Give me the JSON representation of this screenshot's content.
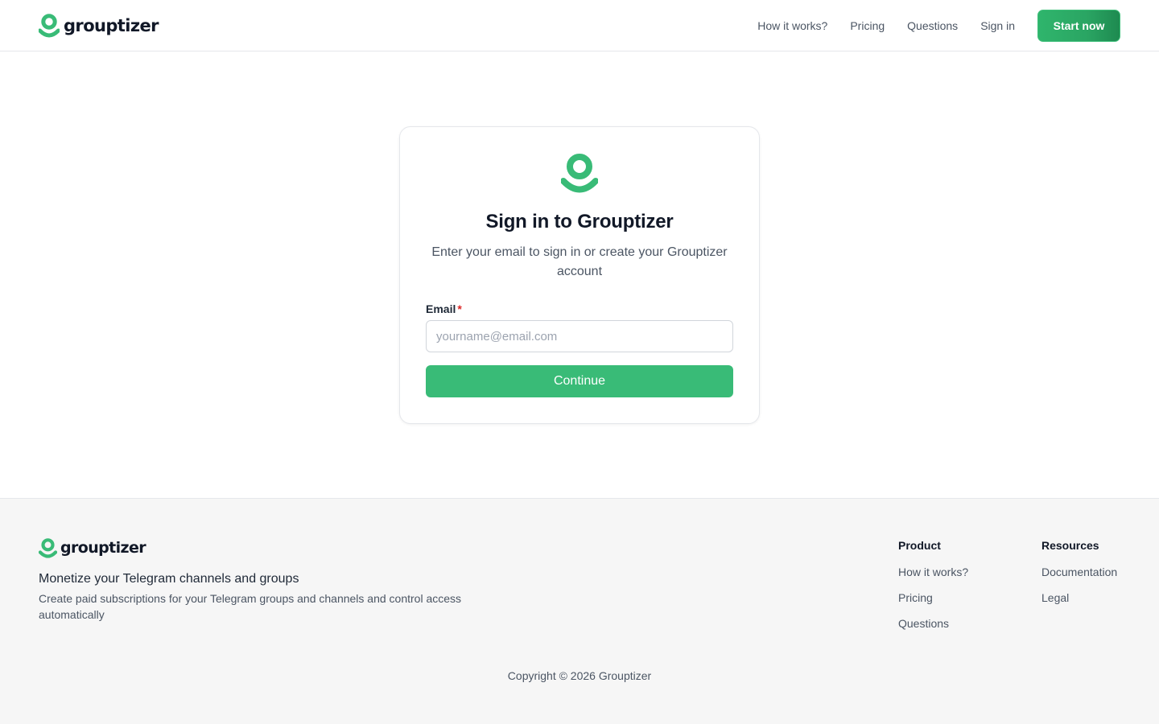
{
  "colors": {
    "brand": "#39bb77",
    "text": "#111827",
    "muted": "#4b5563",
    "required": "#dc2626"
  },
  "header": {
    "brand_name": "grouptizer",
    "logo_icon": "person-pin-icon",
    "nav": {
      "how_it_works": "How it works?",
      "pricing": "Pricing",
      "questions": "Questions",
      "sign_in": "Sign in"
    },
    "cta_label": "Start now"
  },
  "signin": {
    "title": "Sign in to Grouptizer",
    "subtitle": "Enter your email to sign in or create your Grouptizer account",
    "email_label": "Email",
    "required_mark": "*",
    "email_placeholder": "yourname@email.com",
    "email_value": "",
    "continue_label": "Continue"
  },
  "footer": {
    "brand_name": "grouptizer",
    "tagline": "Monetize your Telegram channels and groups",
    "description": "Create paid subscriptions for your Telegram groups and channels and control access automatically",
    "product": {
      "title": "Product",
      "how_it_works": "How it works?",
      "pricing": "Pricing",
      "questions": "Questions"
    },
    "resources": {
      "title": "Resources",
      "documentation": "Documentation",
      "legal": "Legal"
    },
    "copyright": "Copyright © 2026 Grouptizer"
  }
}
